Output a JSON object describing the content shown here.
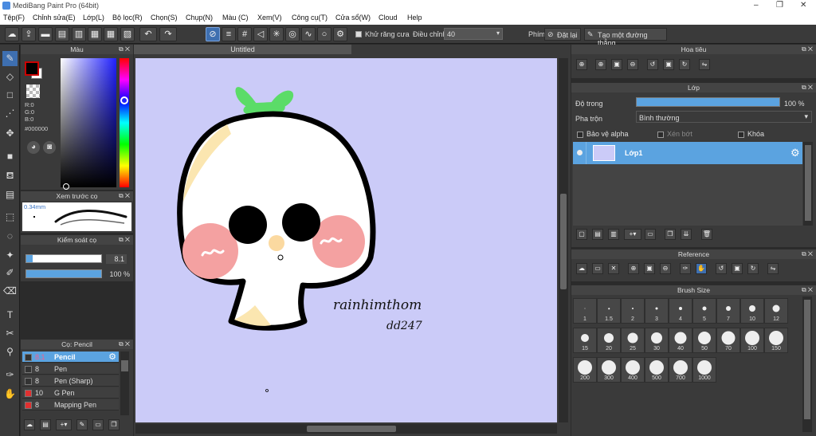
{
  "window": {
    "title": "MediBang Paint Pro (64bit)",
    "minimize": "–",
    "restore": "❐",
    "close": "✕"
  },
  "menu": [
    "Tệp(F)",
    "Chỉnh sửa(E)",
    "Lớp(L)",
    "Bộ lọc(R)",
    "Chọn(S)",
    "Chụp(N)",
    "Màu (C)",
    "Xem(V)",
    "Công cụ(T)",
    "Cửa sổ(W)",
    "Cloud",
    "Help"
  ],
  "toolbar": {
    "antialias_label": "Khử răng cưa",
    "adjust_label": "Điều chỉnh",
    "adjust_value": "40",
    "shortcut_label": "Phím",
    "set_label": "Đặt lại",
    "straight_label": "Tạo một đường thẳng"
  },
  "color_panel": {
    "title": "Màu",
    "r": "R:0",
    "g": "G:0",
    "b": "B:0",
    "hex": "#000000"
  },
  "brush_preview": {
    "title": "Xem trước cọ",
    "size": "0.34mm"
  },
  "brush_control": {
    "title": "Kiểm soát cọ",
    "size_value": "8.1",
    "opacity_value": "100 %",
    "opacity": 1.0,
    "size_fraction": 0.08
  },
  "brush_list": {
    "title": "Cọ: Pencil",
    "items": [
      {
        "size": "8.1",
        "name": "Pencil",
        "color": "#333333",
        "selected": true
      },
      {
        "size": "8",
        "name": "Pen",
        "color": "#333333"
      },
      {
        "size": "8",
        "name": "Pen (Sharp)",
        "color": "#333333"
      },
      {
        "size": "10",
        "name": "G Pen",
        "color": "#e03030"
      },
      {
        "size": "8",
        "name": "Mapping Pen",
        "color": "#e03030"
      }
    ]
  },
  "canvas": {
    "tab_title": "Untitled",
    "bg": "#cbcbf8",
    "signature_line1": "rainhimthom",
    "signature_line2": "dd247"
  },
  "navigator": {
    "title": "Hoa tiêu"
  },
  "layer_panel": {
    "title": "Lớp",
    "opacity_label": "Độ trong",
    "opacity_value": "100 %",
    "opacity": 1.0,
    "blend_label": "Pha trộn",
    "blend_value": "Bình thường",
    "protect_alpha": "Bảo vệ alpha",
    "clip": "Xén bớt",
    "lock": "Khóa",
    "layers": [
      {
        "name": "Lớp1"
      }
    ]
  },
  "reference": {
    "title": "Reference"
  },
  "brush_size": {
    "title": "Brush Size",
    "sizes": [
      "1",
      "1.5",
      "2",
      "3",
      "4",
      "5",
      "7",
      "10",
      "12",
      "15",
      "20",
      "25",
      "30",
      "40",
      "50",
      "70",
      "100",
      "150",
      "200",
      "300",
      "400",
      "500",
      "700",
      "1000"
    ]
  }
}
